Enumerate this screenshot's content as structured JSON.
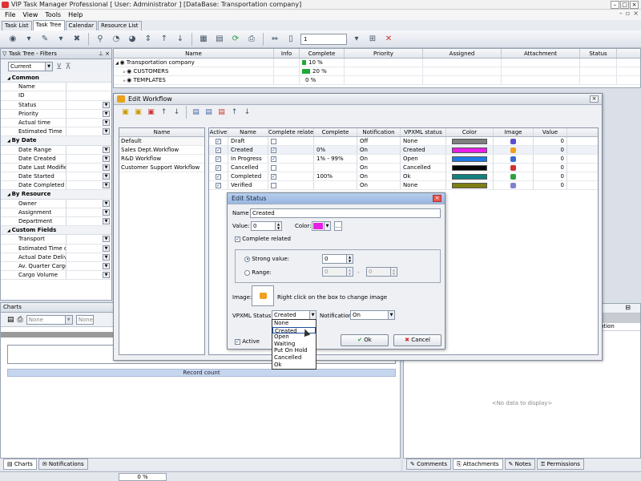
{
  "window": {
    "title": "VIP Task Manager Professional [ User: Administrator ] [DataBase: Transportation company]"
  },
  "menu": [
    "File",
    "View",
    "Tools",
    "Help"
  ],
  "tabs": [
    "Task List",
    "Task Tree",
    "Calendar",
    "Resource List"
  ],
  "toolbar": {
    "page_value": "1"
  },
  "filters": {
    "title": "Task Tree - Filters",
    "current": "Current",
    "categories": [
      {
        "name": "Common",
        "items": [
          "Name",
          "ID",
          "Status",
          "Priority",
          "Actual time",
          "Estimated Time"
        ]
      },
      {
        "name": "By Date",
        "items": [
          "Date Range",
          "Date Created",
          "Date Last Modified",
          "Date Started",
          "Date Completed"
        ]
      },
      {
        "name": "By Resource",
        "items": [
          "Owner",
          "Assignment",
          "Department"
        ]
      },
      {
        "name": "Custom Fields",
        "items": [
          "Transport",
          "Estimated Time of A",
          "Actual Date Deliver",
          "Av. Quarter Cargo V",
          "Cargo Volume"
        ]
      }
    ]
  },
  "task_grid": {
    "columns": [
      "Name",
      "Info",
      "Complete",
      "Priority",
      "Assigned",
      "Attachment",
      "Status"
    ],
    "rows": [
      {
        "name": "Transportation company",
        "complete": "10 %",
        "progress": 0.1
      },
      {
        "name": "CUSTOMERS",
        "complete": "20 %",
        "progress": 0.2
      },
      {
        "name": "TEMPLATES",
        "complete": "0 %",
        "progress": 0.0
      }
    ]
  },
  "charts": {
    "title": "Charts",
    "combo1": "None",
    "combo2": "None",
    "record_count": "Record count"
  },
  "right_panel": {
    "no_data": "<No data to display>",
    "col_hint": "ption"
  },
  "bottom_tabs_left": [
    "Charts",
    "Notifications"
  ],
  "bottom_tabs_right": [
    "Comments",
    "Attachments",
    "Notes",
    "Permissions"
  ],
  "status_bar": {
    "progress": "0 %"
  },
  "edit_workflow": {
    "title": "Edit Workflow",
    "list_header": "Name",
    "workflows": [
      "Default",
      "Sales Dept.Workflow",
      "R&D Workflow",
      "Customer Support Workflow"
    ],
    "columns": [
      "Active",
      "Name",
      "Complete related",
      "Complete",
      "Notification",
      "VPXML status",
      "Color",
      "Image",
      "Value"
    ],
    "rows": [
      {
        "active": true,
        "name": "Draft",
        "complete_related": false,
        "complete": "",
        "notification": "Off",
        "vpxml": "None",
        "color": "#808080",
        "image_color": "#5a4fcf",
        "value": "0"
      },
      {
        "active": true,
        "name": "Created",
        "complete_related": true,
        "complete": "0%",
        "notification": "On",
        "vpxml": "Created",
        "color": "#e61ee6",
        "image_color": "#f0a020",
        "value": "0"
      },
      {
        "active": true,
        "name": "In Progress",
        "complete_related": true,
        "complete": "1% - 99%",
        "notification": "On",
        "vpxml": "Open",
        "color": "#1e78e6",
        "image_color": "#3a6ad0",
        "value": "0"
      },
      {
        "active": true,
        "name": "Cancelled",
        "complete_related": false,
        "complete": "",
        "notification": "On",
        "vpxml": "Cancelled",
        "color": "#050505",
        "image_color": "#d03030",
        "value": "0"
      },
      {
        "active": true,
        "name": "Completed",
        "complete_related": true,
        "complete": "100%",
        "notification": "On",
        "vpxml": "Ok",
        "color": "#128080",
        "image_color": "#30a040",
        "value": "0"
      },
      {
        "active": true,
        "name": "Verified",
        "complete_related": false,
        "complete": "",
        "notification": "On",
        "vpxml": "None",
        "color": "#7f7f14",
        "image_color": "#8080d0",
        "value": "0"
      }
    ]
  },
  "edit_status": {
    "title": "Edit Status",
    "name_label": "Name",
    "name_value": "Created",
    "value_label": "Value:",
    "value_value": "0",
    "color_label": "Color:",
    "color_value": "#e61ee6",
    "complete_related_label": "Complete related",
    "strong_label": "Strong value:",
    "strong_value": "0",
    "range_label": "Range:",
    "range_from": "0",
    "range_sep": "-",
    "range_to": "0",
    "image_label": "Image:",
    "image_hint": "Right click on the box to  change image",
    "vpxml_label": "VPXML Status:",
    "vpxml_value": "Created",
    "notification_label": "Notification:",
    "notification_value": "On",
    "active_label": "Active",
    "ok_label": "Ok",
    "cancel_label": "Cancel",
    "vpxml_options": [
      "None",
      "Created",
      "Open",
      "Waiting",
      "Put On Hold",
      "Cancelled",
      "Ok"
    ],
    "vpxml_highlighted": "Created"
  }
}
